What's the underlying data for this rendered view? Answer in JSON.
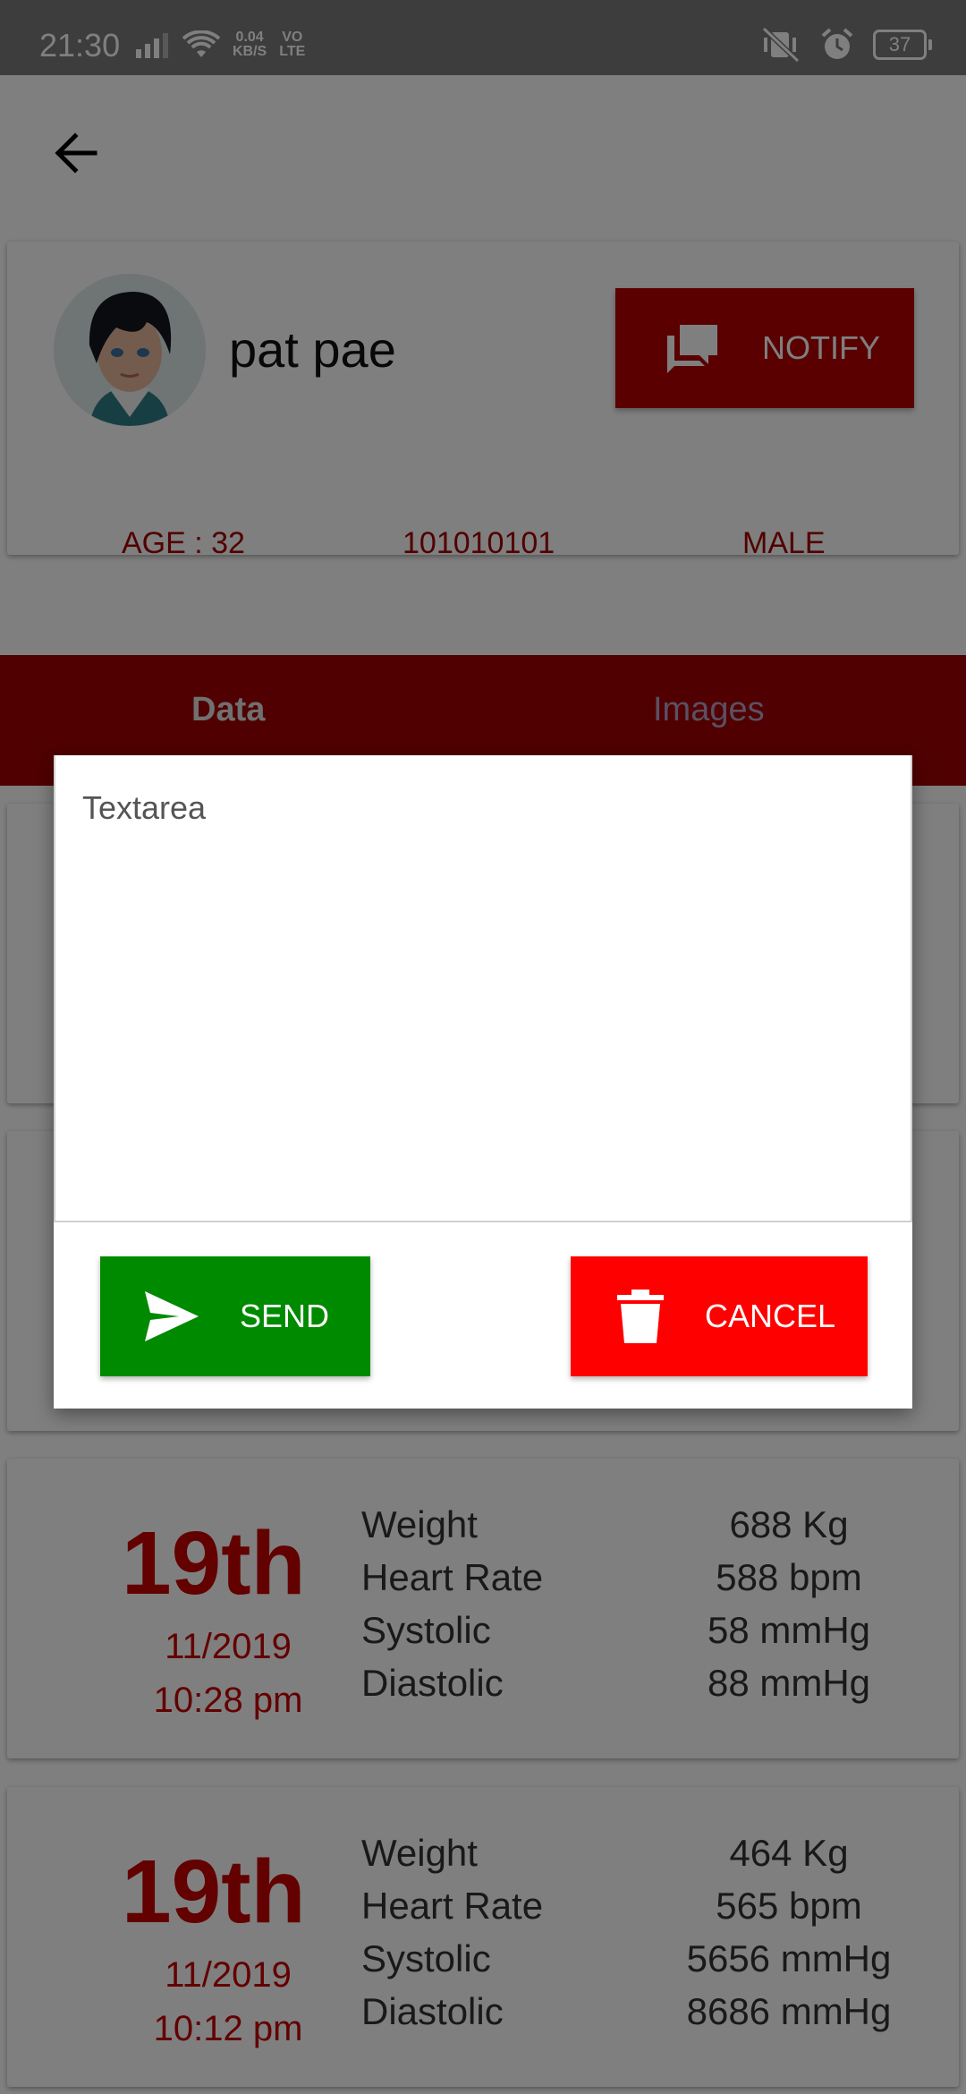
{
  "status_bar": {
    "time": "21:30",
    "net_speed_value": "0.04",
    "net_speed_unit": "KB/S",
    "volte_top": "VO",
    "volte_bottom": "LTE",
    "battery": "37"
  },
  "patient": {
    "name": "pat pae",
    "age": "AGE : 32",
    "id": "101010101",
    "gender": "MALE"
  },
  "toolbar": {
    "notify_label": "NOTIFY"
  },
  "tabs": [
    {
      "label": "Data"
    },
    {
      "label": "Images"
    }
  ],
  "records": [
    {
      "day": "19th",
      "date": "11/2019",
      "time": "10:28 pm",
      "metrics": [
        {
          "label": "Weight",
          "value": "688 Kg"
        },
        {
          "label": "Heart Rate",
          "value": "588 bpm"
        },
        {
          "label": "Systolic",
          "value": "58 mmHg"
        },
        {
          "label": "Diastolic",
          "value": "88 mmHg"
        }
      ]
    },
    {
      "day": "19th",
      "date": "11/2019",
      "time": "10:12 pm",
      "metrics": [
        {
          "label": "Weight",
          "value": "464 Kg"
        },
        {
          "label": "Heart Rate",
          "value": "565 bpm"
        },
        {
          "label": "Systolic",
          "value": "5656 mmHg"
        },
        {
          "label": "Diastolic",
          "value": "8686 mmHg"
        }
      ]
    }
  ],
  "dialog": {
    "textarea_placeholder": "Textarea",
    "send_label": "SEND",
    "cancel_label": "CANCEL"
  },
  "colors": {
    "accent_red": "#a00000",
    "send_green": "#008a00",
    "cancel_red": "#ff0000"
  }
}
